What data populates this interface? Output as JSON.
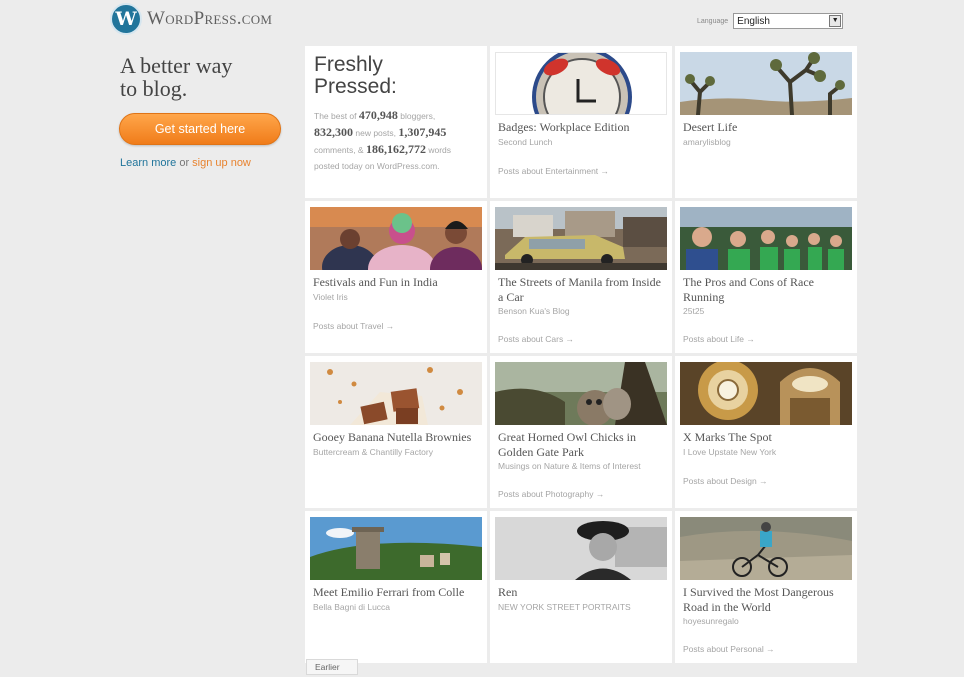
{
  "brand": {
    "logo_letter": "W",
    "name": "WordPress.com",
    "color": "#21759b"
  },
  "language": {
    "label": "Language",
    "selected": "English"
  },
  "hero": {
    "tagline_1": "A better way",
    "tagline_2": "to blog.",
    "cta_label": "Get started here",
    "learn_more": "Learn more",
    "or": "or",
    "sign_up": "sign up now",
    "cta_color": "#f38b2a"
  },
  "freshly_pressed": {
    "title_1": "Freshly",
    "title_2": "Pressed:",
    "pre_bloggers": "The best of",
    "bloggers": "470,948",
    "bloggers_label": "bloggers,",
    "posts": "832,300",
    "posts_label": "new posts,",
    "comments": "1,307,945",
    "comments_label": "comments, &",
    "words": "186,162,772",
    "words_label": "words",
    "footer": "posted today on WordPress.com."
  },
  "posts": [
    {
      "title": "Badges: Workplace Edition",
      "author": "Second Lunch",
      "topic": "Posts about Entertainment →",
      "image": "alarm-clock-badge"
    },
    {
      "title": "Desert Life",
      "author": "amarylisblog",
      "topic": "",
      "image": "joshua-trees"
    },
    {
      "title": "Festivals and Fun in India",
      "author": "Violet Iris",
      "topic": "Posts about Travel →",
      "image": "holi-festival-people"
    },
    {
      "title": "The Streets of Manila from Inside a Car",
      "author": "Benson Kua's Blog",
      "topic": "Posts about Cars →",
      "image": "jeepney-street"
    },
    {
      "title": "The Pros and Cons of Race Running",
      "author": "25t25",
      "topic": "Posts about Life →",
      "image": "race-runners-crowd"
    },
    {
      "title": "Gooey Banana Nutella Brownies",
      "author": "Buttercream & Chantilly Factory",
      "topic": "",
      "image": "brownies"
    },
    {
      "title": "Great Horned Owl Chicks in Golden Gate Park",
      "author": "Musings on Nature & Items of Interest",
      "topic": "Posts about Photography →",
      "image": "owl-chicks"
    },
    {
      "title": "X Marks The Spot",
      "author": "I Love Upstate New York",
      "topic": "Posts about Design →",
      "image": "rotunda-ceiling"
    },
    {
      "title": "Meet Emilio Ferrari from Colle",
      "author": "Bella Bagni di Lucca",
      "topic": "",
      "image": "hill-village"
    },
    {
      "title": "Ren",
      "author": "NEW YORK STREET PORTRAITS",
      "topic": "",
      "image": "street-portrait"
    },
    {
      "title": "I Survived the Most Dangerous Road in the World",
      "author": "hoyesunregalo",
      "topic": "Posts about Personal →",
      "image": "mountain-biker"
    }
  ],
  "pagination": {
    "earlier": "Earlier"
  }
}
